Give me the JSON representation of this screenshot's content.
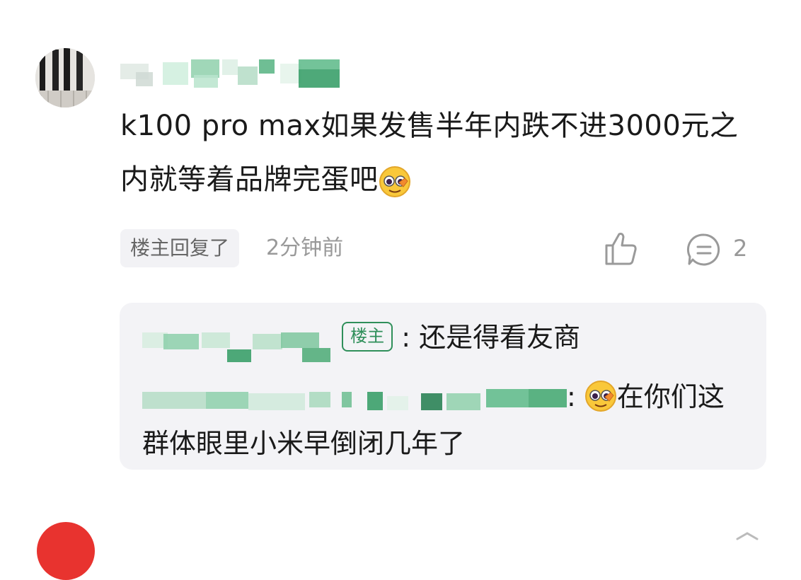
{
  "comment": {
    "username": "",
    "text": "k100 pro max如果发售半年内跌不进3000元之内就等着品牌完蛋吧",
    "emoji_icon": "grimace-emoji-icon",
    "op_replied_label": "楼主回复了",
    "time": "2分钟前",
    "like_icon": "thumbs-up-icon",
    "reply_icon": "comment-icon",
    "reply_count": "2"
  },
  "replies": [
    {
      "user": "",
      "op_badge": "楼主",
      "separator": ":",
      "text": " 还是得看友商"
    },
    {
      "user": "",
      "separator": ":",
      "emoji_icon": "grimace-emoji-icon",
      "text": "在你们这群体眼里小米早倒闭几年了"
    }
  ],
  "next_comment": {
    "username": ""
  },
  "colors": {
    "accent_green": "#2f8f5a",
    "meta_gray": "#999999",
    "reply_bg": "#f3f3f6",
    "badge_bg": "#f2f2f5",
    "next_avatar": "#e8332f"
  }
}
